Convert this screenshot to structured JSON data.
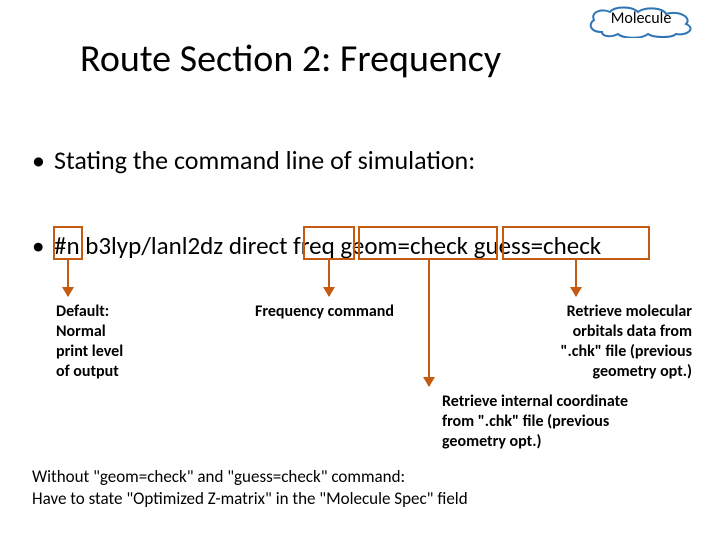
{
  "cloud": {
    "label": "Molecule"
  },
  "title": "Route Section 2: Frequency",
  "bullets": {
    "b1": "Stating the command line of simulation:",
    "cmd_prefix": "#n",
    "cmd_mid": " b3lyp/lanl2dz direct ",
    "cmd_freq": "freq",
    "cmd_sp1": " ",
    "cmd_geom": "geom=check",
    "cmd_sp2": " ",
    "cmd_guess": "guess=check"
  },
  "annotations": {
    "default": "Default:\nNormal\nprint level\nof output",
    "freq": "Frequency command",
    "guess": "Retrieve molecular\norbitals data from\n\".chk\" file (previous\ngeometry opt.)",
    "geom": "Retrieve internal coordinate\nfrom \".chk\" file (previous\ngeometry opt.)"
  },
  "footer": "Without \"geom=check\" and \"guess=check\" command:\nHave to state \"Optimized Z-matrix\" in the \"Molecule Spec\" field",
  "colors": {
    "accent": "#c55a11",
    "cloud_stroke": "#2e75b6"
  }
}
